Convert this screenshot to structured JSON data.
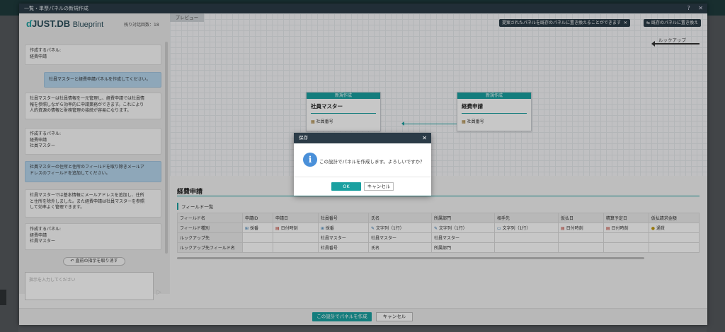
{
  "window": {
    "title": "一覧・単票パネルの新規作成",
    "help": "?",
    "close": "✕"
  },
  "chat": {
    "logo_brand": "JUST.DB",
    "logo_product": "Blueprint",
    "remaining_label": "残り対話回数：18",
    "messages": [
      {
        "role": "system",
        "lines": [
          "作成するパネル:",
          "経費申請"
        ]
      },
      {
        "role": "user",
        "lines": [
          "社員マスターと経費申請パネルを作成してください。"
        ]
      },
      {
        "role": "system",
        "lines": [
          "社員マスターは社員情報を一元管理し、経費申請では社員情",
          "報を参照しながら効率的に申請業務ができます。これにより",
          "人的資源の情報と財務管理の接続が容易になります。"
        ]
      },
      {
        "role": "system",
        "lines": [
          "作成するパネル:",
          "経費申請",
          "社員マスター"
        ]
      },
      {
        "role": "user",
        "lines": [
          "社員マスターの住所と住所のフィールドを取り除きメールア",
          "ドレスのフィールドを追加してください。"
        ]
      },
      {
        "role": "system",
        "lines": [
          "社員マスターでは基本情報にメールアドレスを追加し、住所",
          "と住所を除外しました。また経費申請は社員マスターを参照",
          "して効率よく管理できます。"
        ]
      },
      {
        "role": "system",
        "lines": [
          "作成するパネル:",
          "経費申請",
          "社員マスター"
        ]
      }
    ],
    "undo_label": "直前の指示を取り消す",
    "prompt_placeholder": "指示を入力してください"
  },
  "preview": {
    "tab_label": "プレビュー",
    "suggestion_text": "提案されたパネルを既存のパネルに置き換えることができます",
    "replace_button": "既存のパネルに置き換え",
    "lookup_label": "ルックアップ",
    "nodes": [
      {
        "badge": "新規作成",
        "name": "社員マスター",
        "field": "社員番号"
      },
      {
        "badge": "新規作成",
        "name": "経費申請",
        "field": "社員番号"
      }
    ]
  },
  "detail": {
    "panel_title": "経費申請",
    "field_list_label": "フィールド一覧",
    "row_headers": [
      "フィールド名",
      "フィールド種別",
      "ルックアップ先",
      "ルックアップ先フィールド名"
    ],
    "columns": [
      {
        "name": "申請ID",
        "type": "採番",
        "type_icon": "number-icon",
        "lookup": "",
        "lookup_field": ""
      },
      {
        "name": "申請日",
        "type": "日付時刻",
        "type_icon": "calendar-icon",
        "lookup": "",
        "lookup_field": ""
      },
      {
        "name": "社員番号",
        "type": "採番",
        "type_icon": "number-icon",
        "lookup": "社員マスター",
        "lookup_field": "社員番号"
      },
      {
        "name": "氏名",
        "type": "文字列（1行）",
        "type_icon": "text-icon",
        "lookup": "社員マスター",
        "lookup_field": "氏名"
      },
      {
        "name": "所属部門",
        "type": "文字列（1行）",
        "type_icon": "text-icon",
        "lookup": "社員マスター",
        "lookup_field": "所属部門"
      },
      {
        "name": "相手先",
        "type": "文字列（1行）",
        "type_icon": "text-icon",
        "lookup": "",
        "lookup_field": ""
      },
      {
        "name": "仮払日",
        "type": "日付時刻",
        "type_icon": "calendar-icon",
        "lookup": "",
        "lookup_field": ""
      },
      {
        "name": "精算予定日",
        "type": "日付時刻",
        "type_icon": "calendar-icon",
        "lookup": "",
        "lookup_field": ""
      },
      {
        "name": "仮払請求金額",
        "type": "通貨",
        "type_icon": "currency-icon",
        "lookup": "",
        "lookup_field": ""
      }
    ]
  },
  "footer": {
    "create_button": "この設計でパネルを作成",
    "cancel_button": "キャンセル"
  },
  "dialog": {
    "title": "保存",
    "close": "✕",
    "message": "この設計でパネルを作成します。よろしいですか？",
    "ok_button": "OK",
    "cancel_button": "キャンセル"
  },
  "colors": {
    "accent": "#1aa0a0",
    "titlebar": "#2b3b47",
    "user_bubble": "#b7d6ee",
    "info": "#4a90d9"
  }
}
